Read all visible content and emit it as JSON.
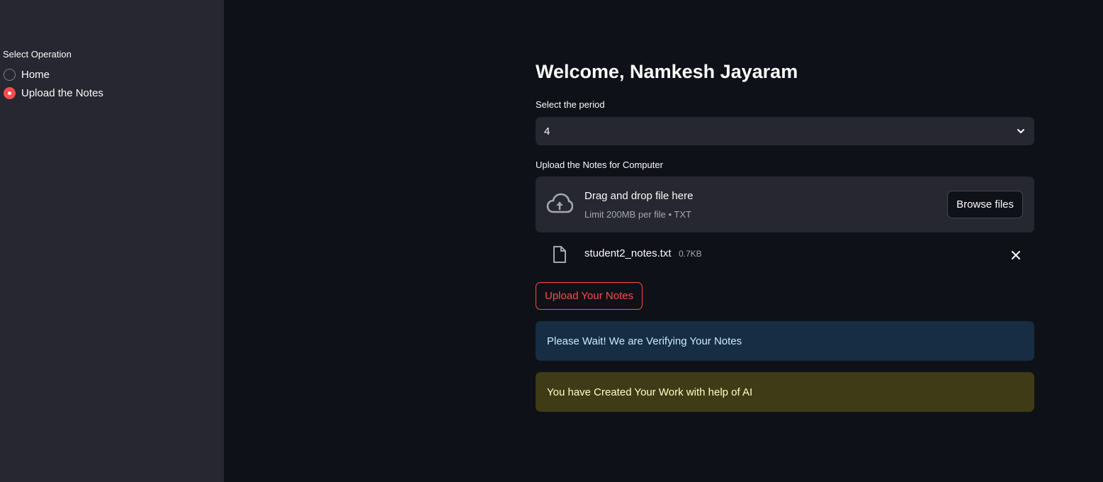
{
  "sidebar": {
    "radio_label": "Select Operation",
    "options": [
      {
        "label": "Home",
        "selected": false
      },
      {
        "label": "Upload the Notes",
        "selected": true
      }
    ]
  },
  "main": {
    "title": "Welcome, Namkesh Jayaram",
    "period_label": "Select the period",
    "period_value": "4",
    "upload_label": "Upload the Notes for Computer",
    "dropzone": {
      "title": "Drag and drop file here",
      "limit": "Limit 200MB per file • TXT",
      "browse_label": "Browse files"
    },
    "file": {
      "name": "student2_notes.txt",
      "size": "0.7KB"
    },
    "upload_button": "Upload Your Notes",
    "info_message": "Please Wait! We are Verifying Your Notes",
    "warning_message": "You have Created Your Work with help of AI"
  },
  "colors": {
    "accent": "#ff4b4b",
    "background": "#0e1117",
    "sidebar": "#262730",
    "info_bg": "#172d43",
    "warning_bg": "#3e3b16"
  },
  "icons": [
    "chevron-down-icon",
    "cloud-upload-icon",
    "file-icon",
    "close-icon"
  ]
}
